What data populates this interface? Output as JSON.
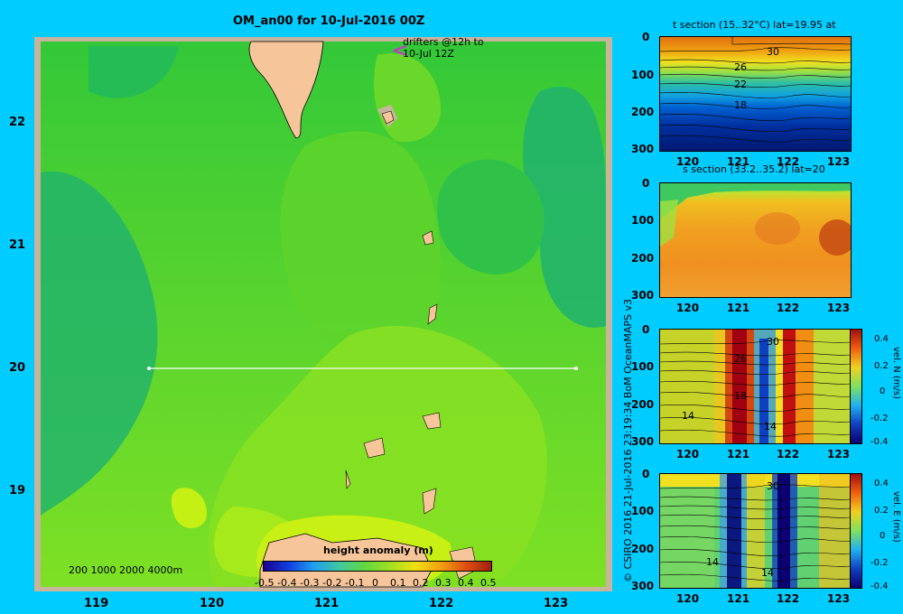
{
  "main": {
    "title": "OM_an00 for 10-Jul-2016 00Z",
    "annotation": "drifters @12h to\n10-Jul 12Z",
    "annotation_line1": "drifters @12h to",
    "annotation_line2": "10-Jul 12Z",
    "depth_legend": "200  1000  2000  4000m",
    "colorbar_label": "height anomaly (m)",
    "colorbar_ticks": [
      "-0.5",
      "-0.4",
      "-0.3",
      "-0.2",
      "-0.1",
      "0",
      "0.1",
      "0.2",
      "0.3",
      "0.4",
      "0.5"
    ],
    "section_latitude": 20,
    "section_lon_range": [
      119.5,
      123.2
    ],
    "arrow_color": "#cc33cc"
  },
  "credit": "© CSIRO 2016   21-Jul-2016 23:19:34 BoM OceanMAPS v3",
  "panels": [
    {
      "id": "t",
      "title": "t section (15..32°C) lat=19.95 at",
      "contour_labels": [
        "30",
        "26",
        "22",
        "18"
      ]
    },
    {
      "id": "s",
      "title": "s section (33.2..35.2) lat=20",
      "contour_labels": []
    },
    {
      "id": "v",
      "title": "",
      "contour_labels": [
        "30",
        "26",
        "18",
        "14",
        "14"
      ],
      "colorbar_label": "vel. N (m/s)",
      "colorbar_ticks": [
        "0.4",
        "0.2",
        "0",
        "-0.2",
        "-0.4"
      ]
    },
    {
      "id": "u",
      "title": "",
      "contour_labels": [
        "30",
        "14",
        "14"
      ],
      "colorbar_label": "vel. E (m/s)",
      "colorbar_ticks": [
        "0.4",
        "0.2",
        "0",
        "-0.2",
        "-0.4"
      ]
    }
  ],
  "chart_data": [
    {
      "type": "heatmap",
      "title": "OM_an00 for 10-Jul-2016 00Z",
      "xlabel": "",
      "ylabel": "",
      "x_ticks": [
        "119",
        "120",
        "121",
        "122",
        "123"
      ],
      "y_ticks": [
        "22",
        "21",
        "20",
        "19"
      ],
      "xlim": [
        118.5,
        123.5
      ],
      "ylim": [
        18.3,
        22.7
      ],
      "colorbar": {
        "label": "height anomaly (m)",
        "range": [
          -0.5,
          0.5
        ]
      }
    },
    {
      "type": "heatmap",
      "title": "t section (15..32°C) lat=19.95 at",
      "x_ticks": [
        "120",
        "121",
        "122",
        "123"
      ],
      "y_ticks": [
        "0",
        "100",
        "200",
        "300"
      ],
      "xlim": [
        119.5,
        123.2
      ],
      "ylim": [
        300,
        0
      ]
    },
    {
      "type": "heatmap",
      "title": "s section (33.2..35.2) lat=20",
      "x_ticks": [
        "120",
        "121",
        "122",
        "123"
      ],
      "y_ticks": [
        "0",
        "100",
        "200",
        "300"
      ],
      "xlim": [
        119.5,
        123.2
      ],
      "ylim": [
        300,
        0
      ]
    },
    {
      "type": "heatmap",
      "title": "",
      "x_ticks": [
        "120",
        "121",
        "122",
        "123"
      ],
      "y_ticks": [
        "0",
        "100",
        "200",
        "300"
      ],
      "xlim": [
        119.5,
        123.2
      ],
      "ylim": [
        300,
        0
      ],
      "colorbar": {
        "label": "vel. N (m/s)",
        "range": [
          -0.4,
          0.4
        ]
      }
    },
    {
      "type": "heatmap",
      "title": "",
      "x_ticks": [
        "120",
        "121",
        "122",
        "123"
      ],
      "y_ticks": [
        "0",
        "100",
        "200",
        "300"
      ],
      "xlim": [
        119.5,
        123.2
      ],
      "ylim": [
        300,
        0
      ],
      "colorbar": {
        "label": "vel. E (m/s)",
        "range": [
          -0.4,
          0.4
        ]
      }
    }
  ]
}
